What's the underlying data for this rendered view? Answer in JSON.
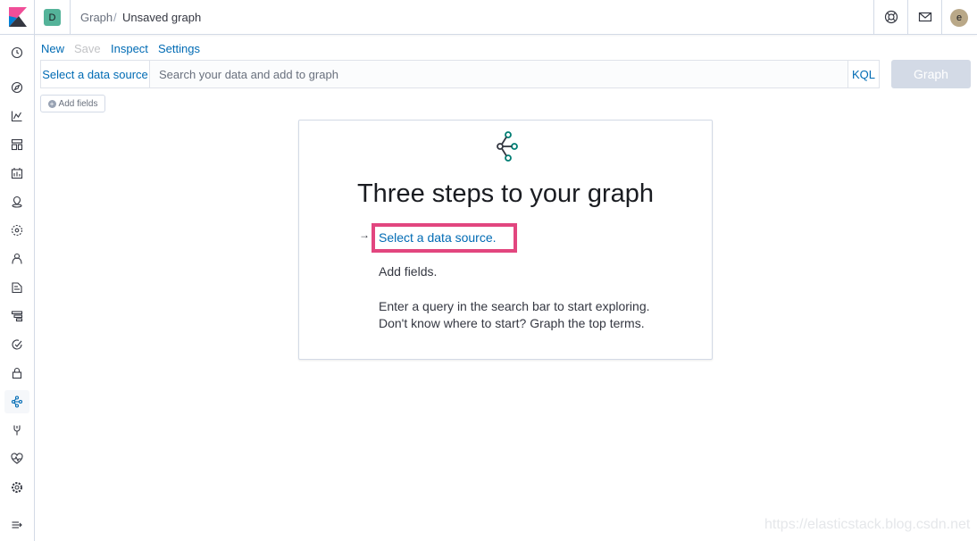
{
  "header": {
    "space_initial": "D",
    "breadcrumb_parent": "Graph",
    "breadcrumb_sep": "/",
    "breadcrumb_current": "Unsaved graph",
    "user_initial": "e",
    "icons": [
      "help-icon",
      "newsfeed-icon"
    ]
  },
  "sidenav": {
    "icons": [
      "recently-viewed-icon",
      "discover-icon",
      "visualize-icon",
      "dashboard-icon",
      "canvas-icon",
      "maps-icon",
      "ml-icon",
      "infrastructure-icon",
      "logs-icon",
      "apm-icon",
      "uptime-icon",
      "siem-icon",
      "graph-icon",
      "dev-tools-icon",
      "monitoring-icon",
      "management-icon",
      "collapse-icon"
    ],
    "active": "graph-icon"
  },
  "menu": {
    "new": "New",
    "save": "Save",
    "inspect": "Inspect",
    "settings": "Settings"
  },
  "querybar": {
    "source_button": "Select a data source",
    "placeholder": "Search your data and add to graph",
    "language": "KQL",
    "submit": "Graph"
  },
  "add_fields": "Add fields",
  "guidance": {
    "title": "Three steps to your graph",
    "arrow": "→",
    "step1": "Select a data source.",
    "step2": "Add fields.",
    "step3_line1": "Enter a query in the search bar to start exploring.",
    "step3_line2": "Don't know where to start? Graph the top terms."
  },
  "colors": {
    "link": "#006bb4",
    "highlight": "#e2467f",
    "space_badge": "#54b399"
  },
  "watermark": "https://elasticstack.blog.csdn.net"
}
